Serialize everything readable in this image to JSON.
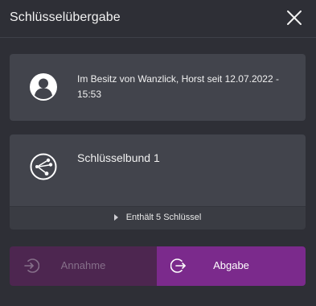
{
  "header": {
    "title": "Schlüsselübergabe",
    "close_icon": "close-icon"
  },
  "owner": {
    "icon": "person-avatar-icon",
    "text": "Im Besitz von Wanzlick, Horst seit 12.07.2022 - 15:53"
  },
  "bundle": {
    "icon": "key-bundle-icon",
    "name": "Schlüsselbund 1",
    "expander_label": "Enthält 5 Schlüssel",
    "expander_icon": "caret-right-icon",
    "expanded": false
  },
  "actions": {
    "annahme": {
      "label": "Annahme",
      "icon": "receive-icon",
      "enabled": false
    },
    "abgabe": {
      "label": "Abgabe",
      "icon": "hand-over-icon",
      "enabled": true
    }
  },
  "colors": {
    "background": "#2e2f36",
    "card": "#42444c",
    "accent": "#7b2a8c",
    "accent_disabled": "#4d2650"
  }
}
